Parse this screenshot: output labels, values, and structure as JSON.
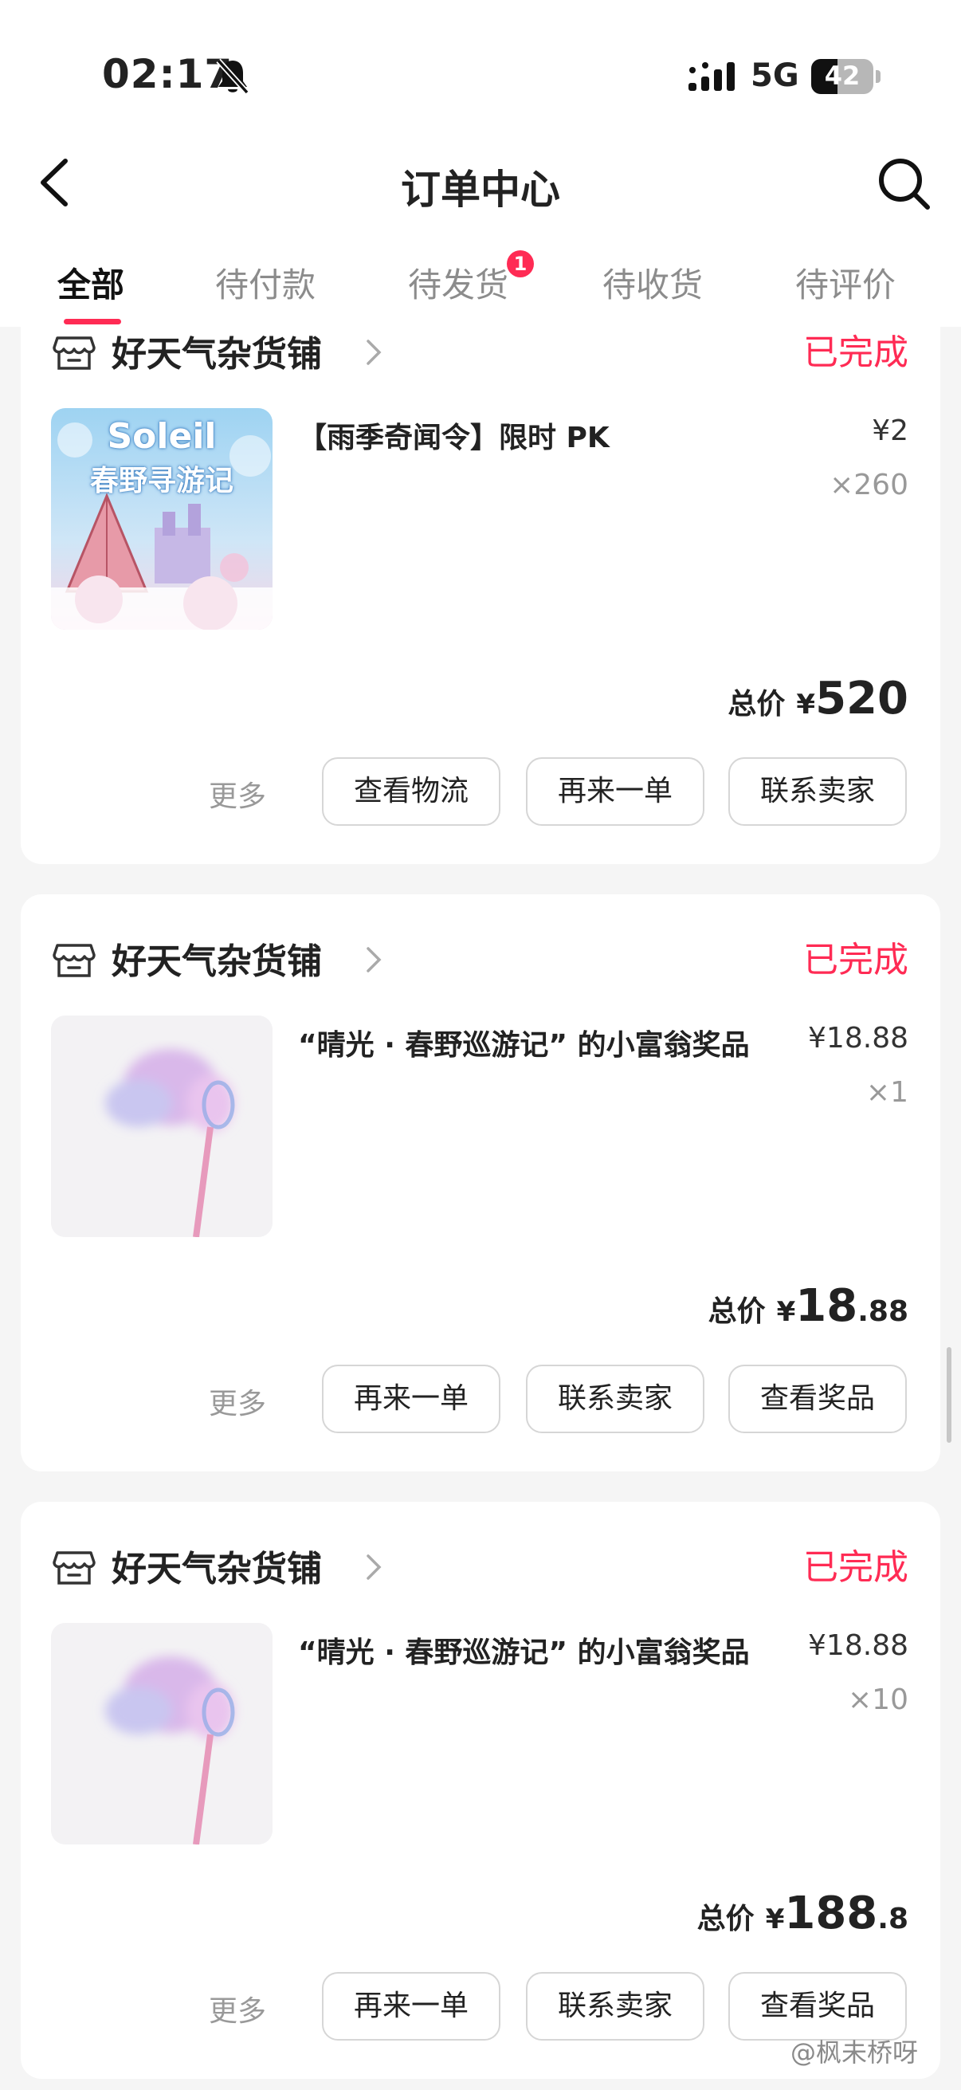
{
  "status_bar": {
    "time": "02:17",
    "network": "5G",
    "battery": "42",
    "battery_level": 0.42
  },
  "header": {
    "title": "订单中心"
  },
  "tabs": [
    {
      "label": "全部",
      "active": true
    },
    {
      "label": "待付款"
    },
    {
      "label": "待发货",
      "badge": "1"
    },
    {
      "label": "待收货"
    },
    {
      "label": "待评价"
    }
  ],
  "orders": [
    {
      "shop": "好天气杂货铺",
      "status": "已完成",
      "product": "【雨季奇闻令】限时 PK",
      "thumb_title": "Soleil",
      "thumb_subtitle": "春野寻游记",
      "price": "¥2",
      "qty": "×260",
      "total_label": "总价",
      "total_currency": "¥",
      "total_int": "520",
      "total_dec": "",
      "more": "更多",
      "buttons": [
        "查看物流",
        "再来一单",
        "联系卖家"
      ]
    },
    {
      "shop": "好天气杂货铺",
      "status": "已完成",
      "product": "“晴光 · 春野巡游记” 的小富翁奖品",
      "price": "¥18.88",
      "qty": "×1",
      "total_label": "总价",
      "total_currency": "¥",
      "total_int": "18",
      "total_dec": ".88",
      "more": "更多",
      "buttons": [
        "再来一单",
        "联系卖家",
        "查看奖品"
      ]
    },
    {
      "shop": "好天气杂货铺",
      "status": "已完成",
      "product": "“晴光 · 春野巡游记” 的小富翁奖品",
      "price": "¥18.88",
      "qty": "×10",
      "total_label": "总价",
      "total_currency": "¥",
      "total_int": "188",
      "total_dec": ".8",
      "more": "更多",
      "buttons": [
        "再来一单",
        "联系卖家",
        "查看奖品"
      ]
    }
  ],
  "watermark": "@枫未桥呀",
  "colors": {
    "accent": "#ff2b54",
    "background": "#f5f5f5",
    "card": "#ffffff"
  }
}
